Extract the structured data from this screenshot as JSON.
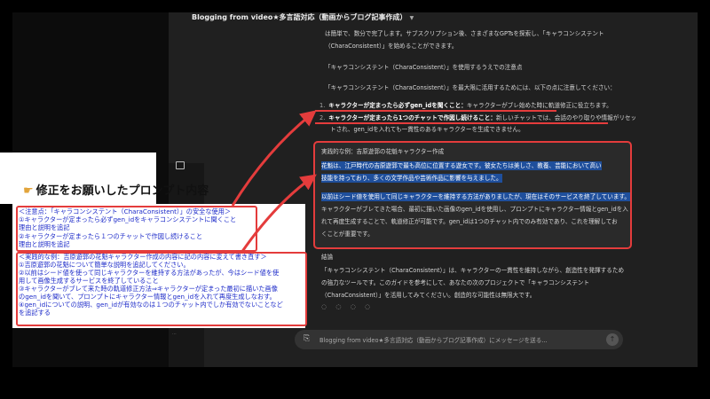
{
  "chat": {
    "title": "Blogging from video★多言語対応（動画からブログ記事作成）",
    "input_placeholder": "Blogging from video★多言語対応（動画からブログ記事作成）にメッセージを送る..."
  },
  "left": {
    "headline": "修正をお願いしたプロンプト内容",
    "tiny_text": "...",
    "note_lines": [
      {
        "pre": "＜注意点：「キャラコンシステント（CharaConsistent）」の安全な使用＞",
        "bold": ""
      },
      {
        "pre": "①キャラクターが定まったら必ずgen_idをキャラコンシステントに聞くこと",
        "bold": ""
      },
      {
        "pre": "理由と説明を追記",
        "bold": ""
      },
      {
        "pre": "②キャラクターが定まったら１つのチャットで作図し続けること",
        "bold": ""
      },
      {
        "pre": "理由と説明を追記",
        "bold": ""
      },
      {
        "pre": "＜実践的な例：吉原遊郭の花魁キャラクター作成の内容に記の内容に変えて書き直す＞",
        "bold": ""
      },
      {
        "pre": "①吉原遊郭の花魁について簡単な説明を追記してください。",
        "bold": ""
      },
      {
        "pre": "②以前はシード値を使って同じキャラクターを維持する方法があったが、今はシード値を使",
        "bold": ""
      },
      {
        "pre": "用して画像生成するサービスを終了していること",
        "bold": ""
      },
      {
        "pre": "③キャラクターがブレて来た時の軌道修正方法⇒キャラクターが定まった最初に描いた画像",
        "bold": ""
      },
      {
        "pre": "のgen_idを聞いて、プロンプトにキャラクター情報とgen_idを入れて再度生成しなおす。",
        "bold": ""
      },
      {
        "pre": "④gen_idについての説明、gen_idが有効なのは１つのチャット内でしか有効でないことなど",
        "bold": ""
      },
      {
        "pre": "を追記する",
        "bold": ""
      }
    ]
  },
  "messages": {
    "intro": "は簡単で、数分で完了します。サブスクリプション後、さまざまなGPTsを探索し、「キャラコンシステント",
    "intro2": "（CharaConsistent）」を始めることができます。",
    "caution_title": "「キャラコンシステント（CharaConsistent）」を使用するうえでの注意点",
    "caution_lead": "「キャラコンシステント（CharaConsistent）」を最大限に活用するためには、以下の点に注意してください：",
    "points": [
      {
        "num": "1.",
        "bold": "キャラクターが定まったら必ずgen_idを聞くこと：",
        "text": "キャラクターがブレ始めた時に軌道修正に役立ちます。"
      },
      {
        "num": "2.",
        "bold": "キャラクターが定まったら1つのチャットで作図し続けること：",
        "text": "新しいチャットでは、会話のやり取りや情報がリセッ"
      }
    ],
    "point2_cont": "トされ、gen_idを入れても一貫性のあるキャラクターを生成できません。",
    "example_title": "実践的な例：吉原遊郭の花魁キャラクター作成",
    "example_lines": [
      "花魁は、江戸時代の吉原遊郭で最も高位に位置する遊女です。彼女たちは美しさ、教養、芸能において高い",
      "技能を持っており、多くの文学作品や芸術作品に影響を与えました。"
    ],
    "example_body": [
      "以前はシード値を使用して同じキャラクターを維持する方法がありましたが、現在はそのサービスを終了しています。",
      "キャラクターがブレてきた場合、最初に描いた画像のgen_idを使用し、プロンプトにキャラクター情報とgen_idを入",
      "れて再度生成することで、軌道修正が可能です。gen_idは1つのチャット内でのみ有効であり、これを理解してお",
      "くことが重要です。"
    ],
    "summary_title": "結論",
    "summary_lines": [
      "「キャラコンシステント（CharaConsistent）」は、キャラクターの一貫性を維持しながら、創造性を発揮するため",
      "の強力なツールです。このガイドを参考にして、あなたの次のプロジェクトで「キャラコンシステント",
      "（CharaConsistent）」を活用してみてください。創造的な可能性は無限大です。"
    ],
    "action_icons": "◌ ◌ ◌ ◌"
  },
  "colors": {
    "accent_red": "#e43c3c",
    "highlight_blue": "#1f4f9c",
    "note_text": "#1d2bc9"
  },
  "icons": [
    "pointing-hand-icon",
    "chevron-down-icon",
    "paperclip-icon",
    "send-icon",
    "arrow-icon"
  ]
}
